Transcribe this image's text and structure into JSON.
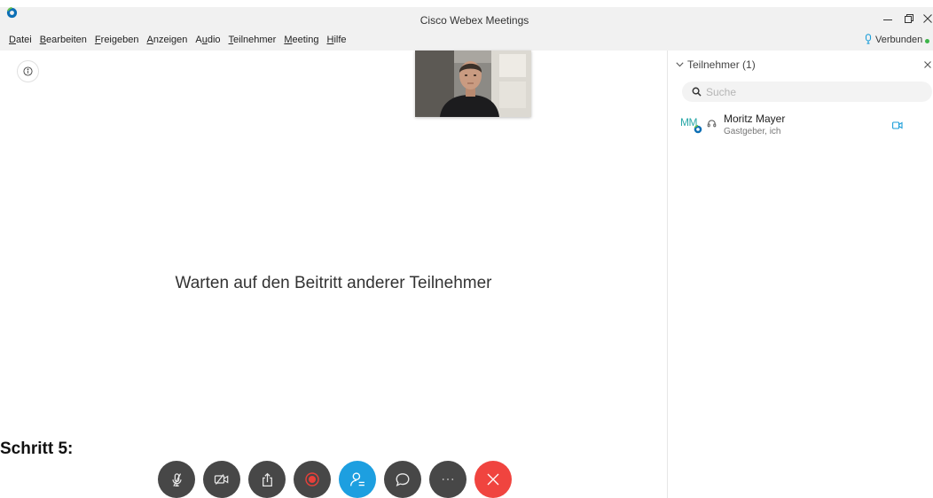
{
  "window": {
    "title": "Cisco Webex Meetings",
    "icons": {
      "logo": "webex-logo-icon",
      "minimize": "minimize-icon",
      "restore": "restore-icon",
      "close": "close-icon"
    }
  },
  "menu": {
    "items": [
      {
        "label": "Datei",
        "mnemonic": "D"
      },
      {
        "label": "Bearbeiten",
        "mnemonic": "B"
      },
      {
        "label": "Freigeben",
        "mnemonic": "F"
      },
      {
        "label": "Anzeigen",
        "mnemonic": "A"
      },
      {
        "label": "Audio",
        "mnemonic": "u"
      },
      {
        "label": "Teilnehmer",
        "mnemonic": "T"
      },
      {
        "label": "Meeting",
        "mnemonic": "M"
      },
      {
        "label": "Hilfe",
        "mnemonic": "H"
      }
    ],
    "connection": {
      "status": "Verbunden",
      "icon": "connection-icon"
    }
  },
  "main": {
    "info_icon": "info-icon",
    "self_view": {
      "visible": true
    },
    "waiting_message": "Warten auf den Beitritt anderer Teilnehmer"
  },
  "annotation": "Schritt 5:",
  "toolbar": {
    "buttons": [
      {
        "icon": "microphone-muted-icon"
      },
      {
        "icon": "video-off-icon"
      },
      {
        "icon": "share-icon"
      },
      {
        "icon": "record-icon"
      },
      {
        "icon": "participants-icon",
        "active": true
      },
      {
        "icon": "chat-icon"
      },
      {
        "icon": "more-icon"
      },
      {
        "icon": "end-call-icon"
      }
    ]
  },
  "participants_panel": {
    "title": "Teilnehmer (1)",
    "search_placeholder": "Suche",
    "participants": [
      {
        "initials": "MM",
        "name": "Moritz Mayer",
        "role": "Gastgeber, ich",
        "audio_icon": "headset-icon",
        "video_icon": "video-camera-icon"
      }
    ]
  },
  "colors": {
    "accent_blue": "#1d9fe0",
    "end_red": "#f0443f",
    "record_red": "#e8403a",
    "button_dark": "#474747",
    "initials_teal": "#2aa8a8",
    "status_green": "#3db54a",
    "icon_blue": "#1a9dd9"
  }
}
